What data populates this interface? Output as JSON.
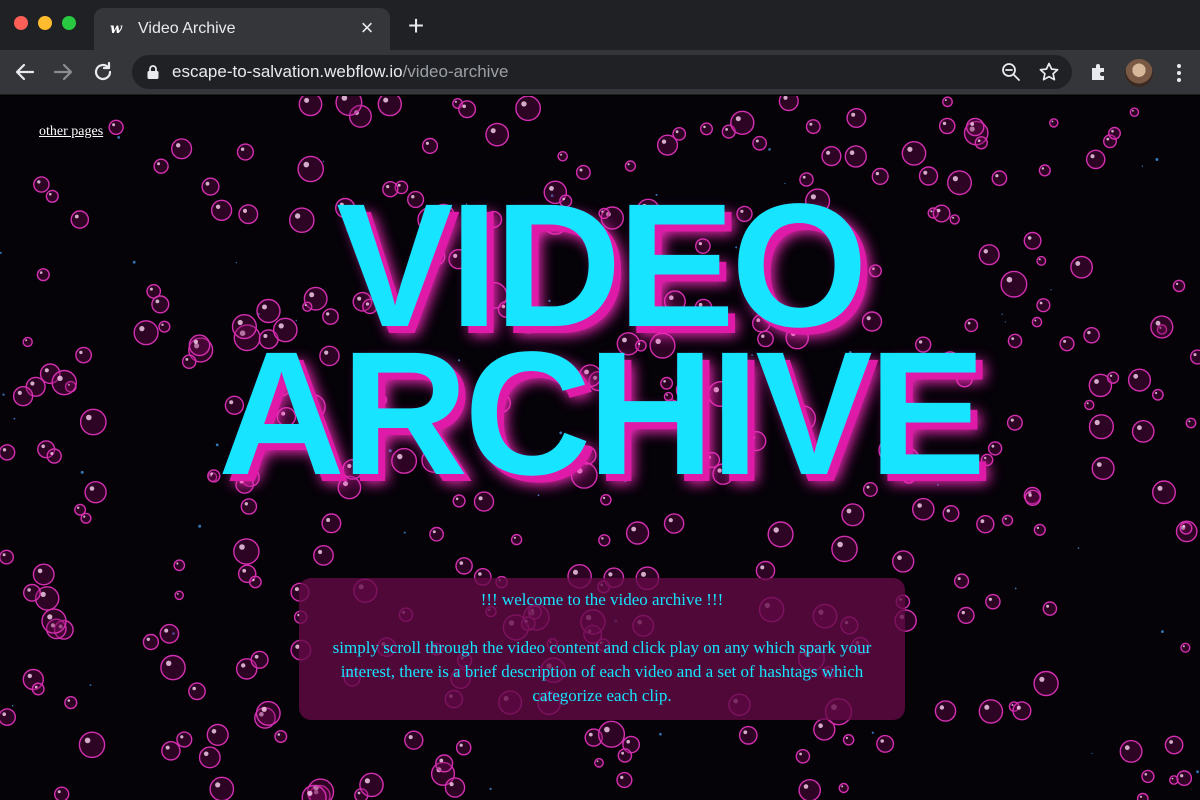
{
  "browser": {
    "tab": {
      "title": "Video Archive",
      "favicon": "w"
    },
    "new_tab_label": "+",
    "close_label": "×",
    "url": {
      "host": "escape-to-salvation.webflow.io",
      "path": "/video-archive"
    },
    "icons": [
      "back-arrow-icon",
      "forward-arrow-icon",
      "reload-icon",
      "lock-icon",
      "zoom-icon",
      "star-icon",
      "extensions-icon",
      "avatar",
      "kebab-menu-icon"
    ]
  },
  "page": {
    "nav_link": "other pages",
    "hero": {
      "line1": "VIDEO",
      "line2": "ARCHIVE"
    },
    "intro": {
      "welcome": "!!! welcome to the video archive !!!",
      "body": "simply scroll through the video content and click play on any which spark your interest, there is a brief description of each video and a set of hashtags which categorize each clip."
    },
    "colors": {
      "background": "#050208",
      "hero_text": "#17e4ff",
      "hero_shadow": "#e01aa8",
      "bubble": "#d42fb0",
      "intro_text": "#17e4ff",
      "intro_box": "#640a46"
    }
  }
}
